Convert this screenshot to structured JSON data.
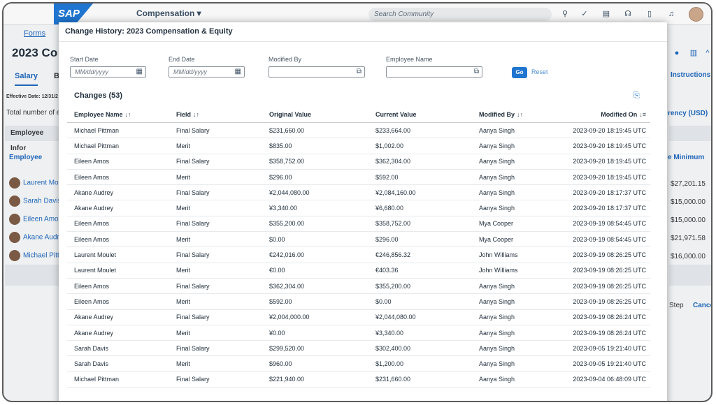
{
  "shell": {
    "logo": "SAP",
    "app_menu": "Compensation ▾",
    "search_placeholder": "Search Community",
    "icons": [
      "search-icon",
      "check-circle-icon",
      "notes-icon",
      "headset-icon",
      "book-icon",
      "bell-icon"
    ]
  },
  "background": {
    "forms_link": "Forms",
    "page_title": "2023 Co",
    "tab_salary": "Salary",
    "tab_b": "B",
    "effective_date": "Effective Date: 12/31/2",
    "total_number": "Total number of er",
    "employee_info": "Employee Infor",
    "employee_header": "Employee",
    "employees": [
      "Laurent Mou",
      "Sarah Davis",
      "Eileen Amos",
      "Akane Audre",
      "Michael Pitt"
    ],
    "instructions": "Instructions",
    "currency": "rency (USD)",
    "minimum_header": "e Minimum",
    "minimum_values": [
      "$27,201.15",
      "$15,000.00",
      "$15,000.00",
      "$21,971.58",
      "$16,000.00"
    ],
    "step_label": "Step",
    "cancel_label": "Cancel"
  },
  "dialog": {
    "title": "Change History: 2023 Compensation & Equity",
    "filters": {
      "start_date_label": "Start Date",
      "start_date_placeholder": "MM/dd/yyyy",
      "end_date_label": "End Date",
      "end_date_placeholder": "MM/dd/yyyy",
      "modified_by_label": "Modified By",
      "employee_name_label": "Employee Name",
      "go_label": "Go",
      "reset_label": "Reset"
    },
    "changes_title": "Changes (53)",
    "columns": [
      "Employee Name",
      "Field",
      "Original Value",
      "Current Value",
      "Modified By",
      "Modified On"
    ],
    "rows": [
      [
        "Michael Pittman",
        "Final Salary",
        "$231,660.00",
        "$233,664.00",
        "Aanya Singh",
        "2023-09-20 18:19:45 UTC"
      ],
      [
        "Michael Pittman",
        "Merit",
        "$835.00",
        "$1,002.00",
        "Aanya Singh",
        "2023-09-20 18:19:45 UTC"
      ],
      [
        "Eileen Amos",
        "Final Salary",
        "$358,752.00",
        "$362,304.00",
        "Aanya Singh",
        "2023-09-20 18:19:45 UTC"
      ],
      [
        "Eileen Amos",
        "Merit",
        "$296.00",
        "$592.00",
        "Aanya Singh",
        "2023-09-20 18:19:45 UTC"
      ],
      [
        "Akane Audrey",
        "Final Salary",
        "¥2,044,080.00",
        "¥2,084,160.00",
        "Aanya Singh",
        "2023-09-20 18:17:37 UTC"
      ],
      [
        "Akane Audrey",
        "Merit",
        "¥3,340.00",
        "¥6,680.00",
        "Aanya Singh",
        "2023-09-20 18:17:37 UTC"
      ],
      [
        "Eileen Amos",
        "Final Salary",
        "$355,200.00",
        "$358,752.00",
        "Mya Cooper",
        "2023-09-19 08:54:45 UTC"
      ],
      [
        "Eileen Amos",
        "Merit",
        "$0.00",
        "$296.00",
        "Mya Cooper",
        "2023-09-19 08:54:45 UTC"
      ],
      [
        "Laurent Moulet",
        "Final Salary",
        "€242,016.00",
        "€246,856.32",
        "John Williams",
        "2023-09-19 08:26:25 UTC"
      ],
      [
        "Laurent Moulet",
        "Merit",
        "€0.00",
        "€403.36",
        "John Williams",
        "2023-09-19 08:26:25 UTC"
      ],
      [
        "Eileen Amos",
        "Final Salary",
        "$362,304.00",
        "$355,200.00",
        "Aanya Singh",
        "2023-09-19 08:26:25 UTC"
      ],
      [
        "Eileen Amos",
        "Merit",
        "$592.00",
        "$0.00",
        "Aanya Singh",
        "2023-09-19 08:26:25 UTC"
      ],
      [
        "Akane Audrey",
        "Final Salary",
        "¥2,004,000.00",
        "¥2,044,080.00",
        "Aanya Singh",
        "2023-09-19 08:26:24 UTC"
      ],
      [
        "Akane Audrey",
        "Merit",
        "¥0.00",
        "¥3,340.00",
        "Aanya Singh",
        "2023-09-19 08:26:24 UTC"
      ],
      [
        "Sarah Davis",
        "Final Salary",
        "$299,520.00",
        "$302,400.00",
        "Aanya Singh",
        "2023-09-05 19:21:40 UTC"
      ],
      [
        "Sarah Davis",
        "Merit",
        "$960.00",
        "$1,200.00",
        "Aanya Singh",
        "2023-09-05 19:21:40 UTC"
      ],
      [
        "Michael Pittman",
        "Final Salary",
        "$221,940.00",
        "$231,660.00",
        "Aanya Singh",
        "2023-09-04 06:48:09 UTC"
      ]
    ]
  }
}
